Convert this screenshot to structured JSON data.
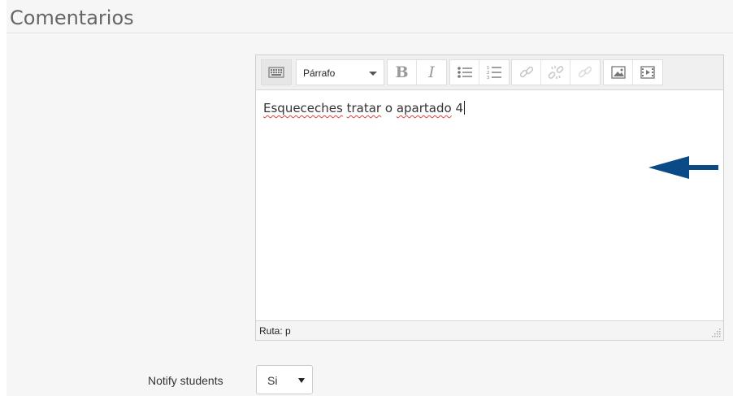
{
  "section": {
    "title": "Comentarios"
  },
  "editor": {
    "toolbar": {
      "toggle_icon": "keyboard-icon",
      "format_select": "Párrafo",
      "bold_label": "B",
      "italic_label": "I",
      "icons": [
        "bullet-list-icon",
        "numbered-list-icon",
        "link-icon",
        "unlink-icon",
        "anchor-icon",
        "image-icon",
        "media-icon"
      ]
    },
    "content": {
      "words": [
        {
          "text": "Esqueceches",
          "misspelled": true
        },
        {
          "text": "tratar",
          "misspelled": true
        },
        {
          "text": "o",
          "misspelled": false
        },
        {
          "text": "apartado",
          "misspelled": true
        },
        {
          "text": "4",
          "misspelled": false
        }
      ]
    },
    "status_path": "Ruta: p"
  },
  "annotation": {
    "color": "#0a4a86",
    "icon": "arrow-left-icon"
  },
  "notify": {
    "label": "Notify students",
    "selected": "Si"
  },
  "colors": {
    "panel_bg": "#f6f6f6",
    "spell_underline": "#e04040"
  }
}
